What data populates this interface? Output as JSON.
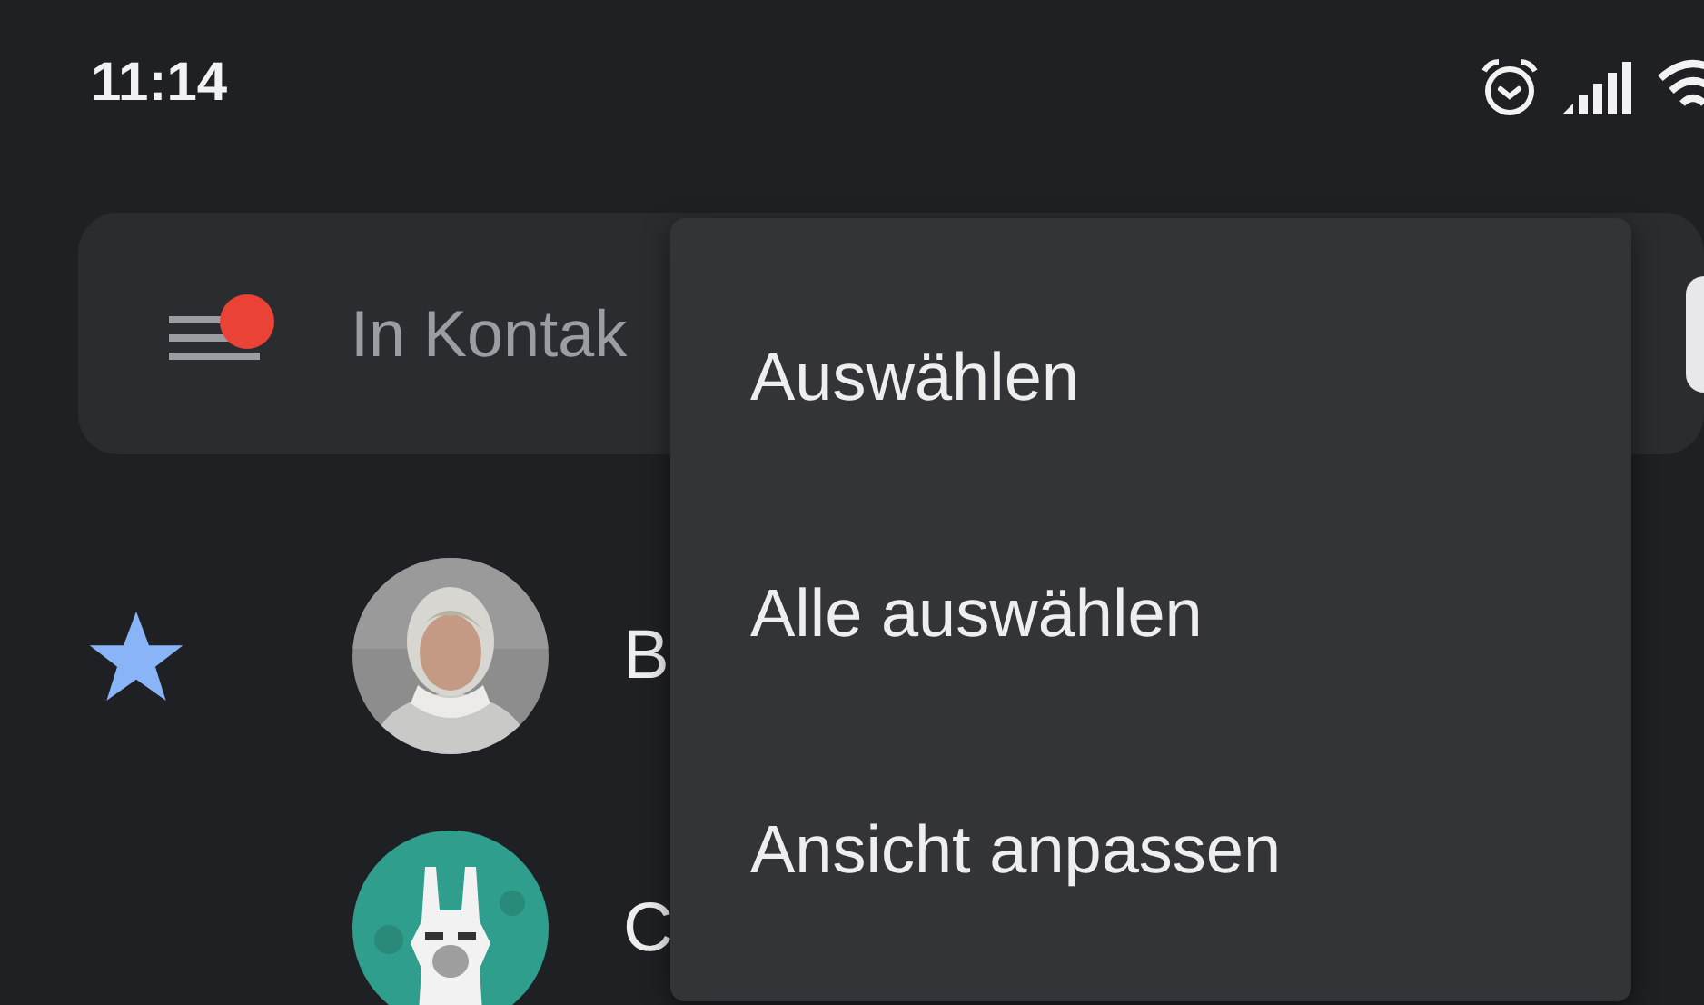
{
  "status_bar": {
    "time": "11:14"
  },
  "search_bar": {
    "placeholder": "In Kontak",
    "notification_dot": true
  },
  "contacts": [
    {
      "name": "B",
      "starred": true
    },
    {
      "name": "C",
      "starred": false
    }
  ],
  "menu": {
    "items": [
      {
        "label": "Auswählen"
      },
      {
        "label": "Alle auswählen"
      },
      {
        "label": "Ansicht anpassen"
      }
    ]
  }
}
